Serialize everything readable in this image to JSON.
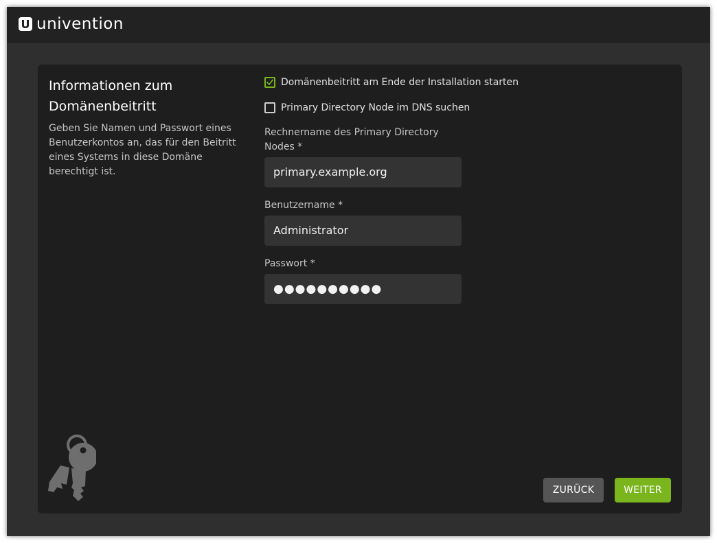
{
  "header": {
    "brand": "univention",
    "logo_icon": "univention-u-icon"
  },
  "info": {
    "title": "Informationen zum Domänenbeitritt",
    "description": "Geben Sie Namen und Passwort eines Benutzerkontos an, das für den Beitritt eines Systems in diese Domäne berechtigt ist.",
    "icon": "keys-icon"
  },
  "form": {
    "join_at_end": {
      "label": "Domänenbeitritt am Ende der Installation starten",
      "checked": true
    },
    "search_dns": {
      "label": "Primary Directory Node im DNS suchen",
      "checked": false
    },
    "hostname": {
      "label": "Rechnername des Primary Directory Nodes *",
      "value": "primary.example.org"
    },
    "username": {
      "label": "Benutzername *",
      "value": "Administrator"
    },
    "password": {
      "label": "Passwort *",
      "value": "●●●●●●●●●●"
    }
  },
  "buttons": {
    "back": "ZURÜCK",
    "next": "WEITER"
  },
  "colors": {
    "accent": "#7ab51d",
    "header_bg": "#222222",
    "page_bg": "#2f2f2f",
    "card_bg": "#1e1e1e",
    "input_bg": "#333333",
    "secondary_button": "#555555"
  }
}
